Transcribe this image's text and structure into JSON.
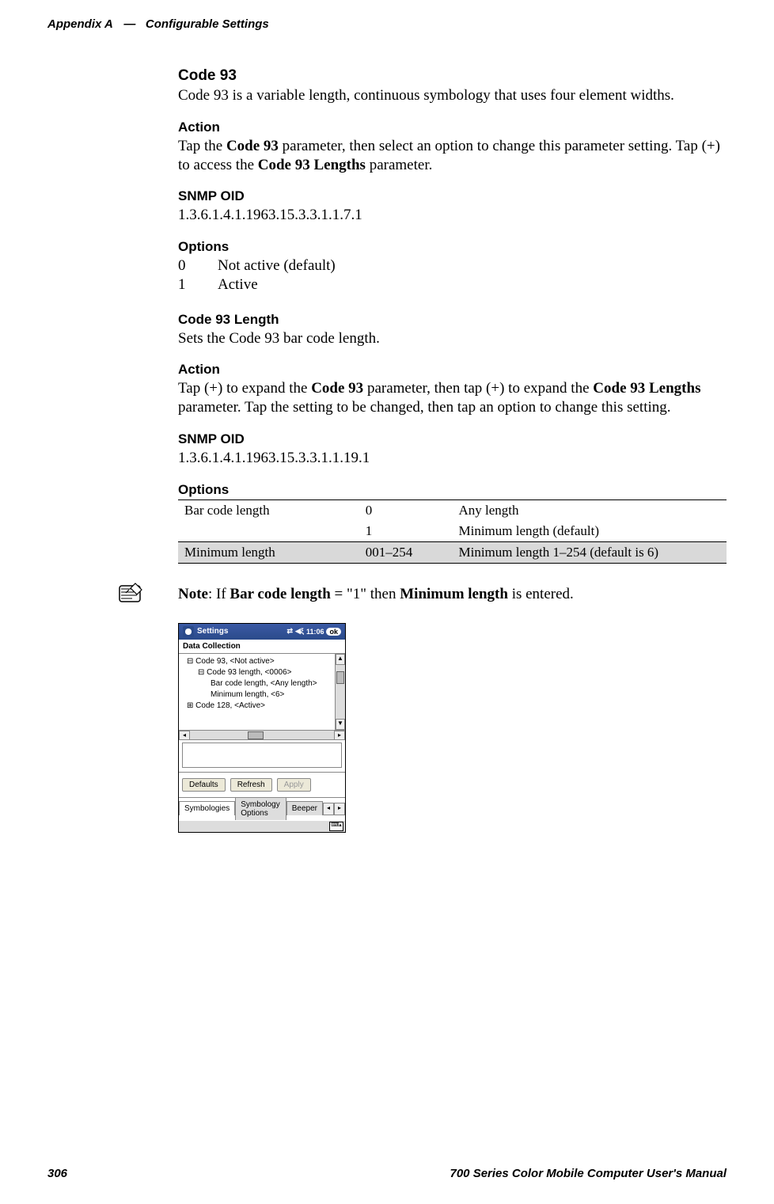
{
  "header": {
    "appendix": "Appendix A",
    "dash": "—",
    "section": "Configurable Settings"
  },
  "code93": {
    "title": "Code 93",
    "desc": "Code 93 is a variable length, continuous symbology that uses four element widths.",
    "action_h": "Action",
    "action_p_pre": "Tap the ",
    "action_p_b1": "Code 93",
    "action_p_mid": " parameter, then select an option to change this parameter setting. Tap (+) to access the ",
    "action_p_b2": "Code 93 Lengths",
    "action_p_end": " parameter.",
    "snmp_h": "SNMP OID",
    "snmp_v": "1.3.6.1.4.1.1963.15.3.3.1.1.7.1",
    "options_h": "Options",
    "options": [
      {
        "num": "0",
        "label": "Not active (default)"
      },
      {
        "num": "1",
        "label": "Active"
      }
    ]
  },
  "code93len": {
    "title": "Code 93 Length",
    "desc": "Sets the Code 93 bar code length.",
    "action_h": "Action",
    "action_p_pre": "Tap (+) to expand the ",
    "action_p_b1": "Code 93",
    "action_p_mid": " parameter, then tap (+) to expand the ",
    "action_p_b2": "Code 93 Lengths",
    "action_p_end": " parameter. Tap the setting to be changed, then tap an option to change this setting.",
    "snmp_h": "SNMP OID",
    "snmp_v": "1.3.6.1.4.1.1963.15.3.3.1.1.19.1",
    "options_h": "Options",
    "table": {
      "row1": {
        "c1": "Bar code length",
        "c2a": "0",
        "c2b": "1",
        "c3a": "Any length",
        "c3b": "Minimum length (default)"
      },
      "row2": {
        "c1": "Minimum length",
        "c2": "001–254",
        "c3": "Minimum length 1–254 (default is 6)"
      }
    }
  },
  "note": {
    "label": "Note",
    "pre": ": If ",
    "b1": "Bar code length",
    "mid": " = \"1\" then ",
    "b2": "Minimum length",
    "end": " is entered."
  },
  "pda": {
    "settings_label": "Settings",
    "time": "11:06",
    "ok": "ok",
    "app_title": "Data Collection",
    "tree": {
      "l1": "Code 93, <Not active>",
      "l2": "Code 93 length, <0006>",
      "l3": "Bar code length, <Any length>",
      "l4": "Minimum length, <6>",
      "l5": "Code 128, <Active>"
    },
    "buttons": {
      "defaults": "Defaults",
      "refresh": "Refresh",
      "apply": "Apply"
    },
    "tabs": {
      "t1": "Symbologies",
      "t2": "Symbology Options",
      "t3": "Beeper"
    }
  },
  "footer": {
    "page": "306",
    "book": "700 Series Color Mobile Computer User's Manual"
  }
}
